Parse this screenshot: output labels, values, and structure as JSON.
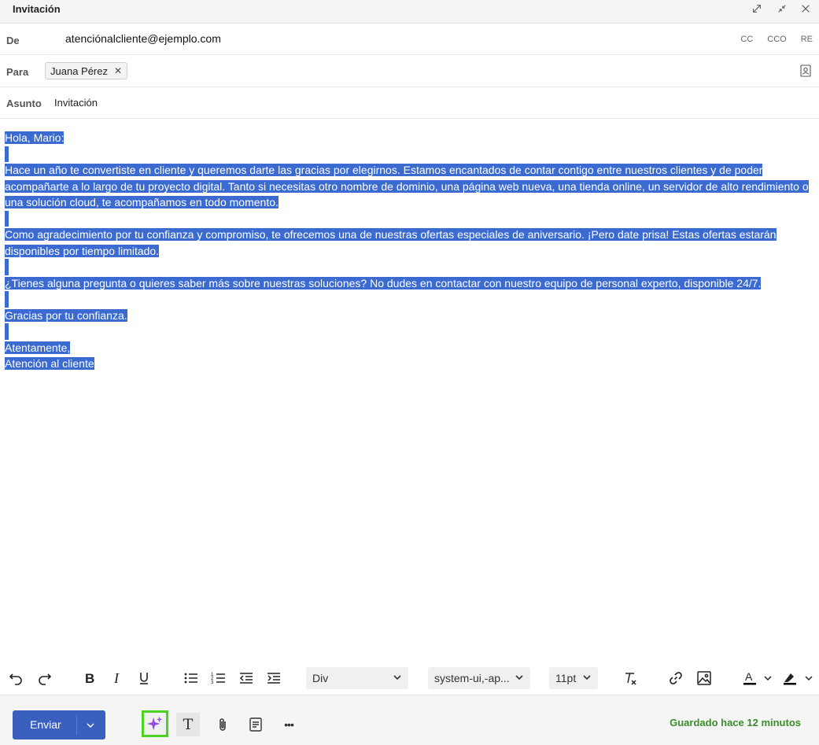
{
  "window": {
    "title": "Invitación",
    "controls": [
      "popout-icon",
      "minimize-icon",
      "close-icon"
    ]
  },
  "from": {
    "label": "De",
    "value": "atenciónalcliente@ejemplo.com",
    "options": [
      "CC",
      "CCO",
      "RE"
    ]
  },
  "to": {
    "label": "Para",
    "recipient": "Juana Pérez",
    "remove": "✕"
  },
  "subject": {
    "label": "Asunto",
    "value": "Invitación"
  },
  "message": {
    "lines": [
      "Hola, Mario:",
      "",
      "Hace un año te convertiste en cliente y queremos darte las gracias por elegirnos. Estamos encantados de contar contigo entre nuestros clientes y de poder acompañarte a lo largo de tu proyecto digital. Tanto si necesitas otro nombre de dominio, una página web nueva, una tienda online, un servidor de alto rendimiento o una solución cloud, te acompañamos en todo momento.",
      "",
      "Como agradecimiento por tu confianza y compromiso, te ofrecemos una de nuestras ofertas especiales de aniversario. ¡Pero date prisa! Estas ofertas estarán disponibles por tiempo limitado.",
      "",
      "¿Tienes alguna pregunta o quieres saber más sobre nuestras soluciones? No dudes en contactar con nuestro equipo de personal experto, disponible 24/7.",
      "",
      "Gracias por tu confianza.",
      "",
      "Atentamente,",
      "Atención al cliente"
    ],
    "selection_color": "#3b6bd1"
  },
  "format_toolbar": {
    "block_format": "Div",
    "font_family": "system-ui,-ap...",
    "font_size": "11pt",
    "text_color_label": "A",
    "text_color": "#000000"
  },
  "footer": {
    "send_label": "Enviar",
    "saved_status": "Guardado hace 12 minutos",
    "text_format_label": "T",
    "more_label": "•••",
    "accent_color": "#3a5fbf",
    "highlight_border_color": "#4cd424"
  }
}
